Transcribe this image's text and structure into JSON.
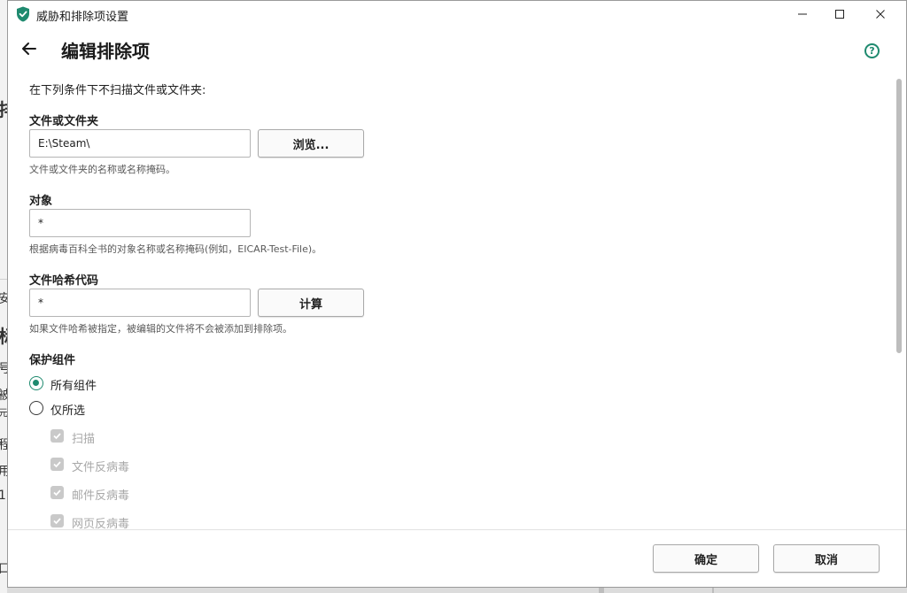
{
  "window": {
    "title": "威胁和排除项设置"
  },
  "header": {
    "title": "编辑排除项"
  },
  "form": {
    "intro": "在下列条件下不扫描文件或文件夹:",
    "file_or_folder": {
      "label": "文件或文件夹",
      "value": "E:\\Steam\\",
      "browse_label": "浏览...",
      "hint": "文件或文件夹的名称或名称掩码。"
    },
    "object": {
      "label": "对象",
      "value": "*",
      "hint": "根据病毒百科全书的对象名称或名称掩码(例如，EICAR-Test-File)。"
    },
    "file_hash": {
      "label": "文件哈希代码",
      "value": "*",
      "calc_label": "计算",
      "hint": "如果文件哈希被指定，被编辑的文件将不会被添加到排除项。"
    },
    "protection": {
      "label": "保护组件",
      "options": [
        "所有组件",
        "仅所选"
      ],
      "selected": "所有组件",
      "components": [
        "扫描",
        "文件反病毒",
        "邮件反病毒",
        "网页反病毒"
      ]
    }
  },
  "footer": {
    "ok_label": "确定",
    "cancel_label": "取消"
  },
  "background": {
    "fragments": [
      "排",
      "安",
      "标",
      "号",
      "被",
      "元",
      "程",
      "用",
      "1",
      "口"
    ]
  },
  "colors": {
    "accent": "#1f8a6f",
    "disabled_check": "#c9c9c9",
    "disabled_text": "#a8a8a8"
  }
}
